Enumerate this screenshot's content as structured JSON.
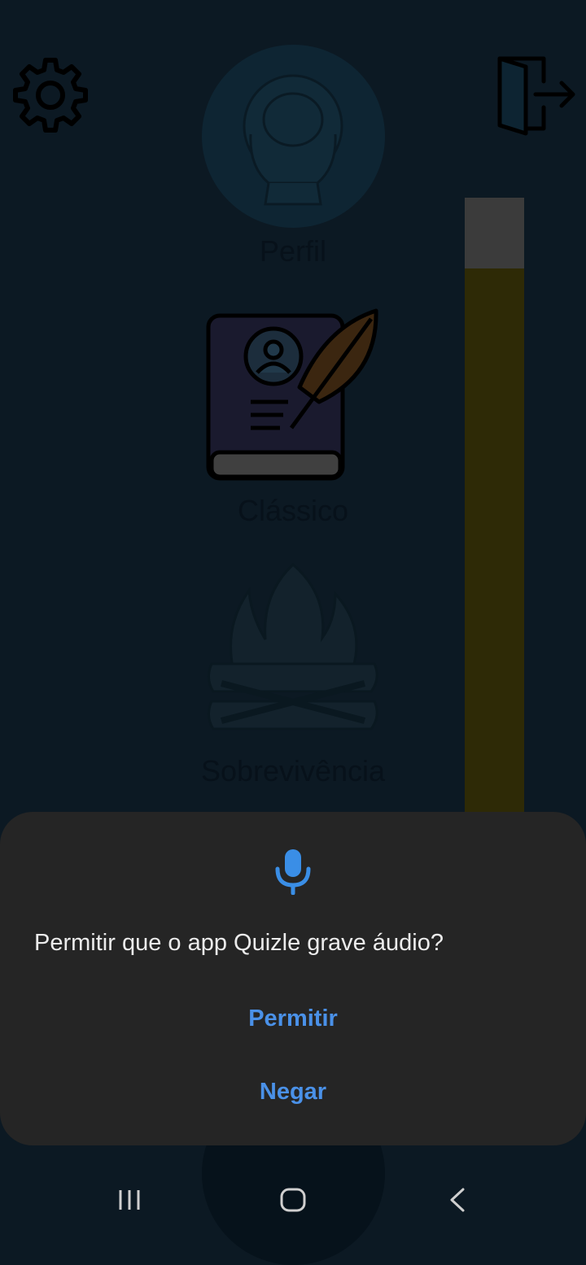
{
  "menu": {
    "profile_label": "Perfil",
    "classic_label": "Clássico",
    "survival_label": "Sobrevivência",
    "progress_fraction": 0.885
  },
  "dialog": {
    "message": "Permitir que o app Quizle grave áudio?",
    "allow_label": "Permitir",
    "deny_label": "Negar",
    "accent_color": "#4a91e8"
  },
  "icons": {
    "settings": "gear-icon",
    "logout": "exit-door-icon",
    "profile": "user-avatar-icon",
    "classic": "book-quill-icon",
    "survival": "campfire-icon",
    "permission": "microphone-icon"
  },
  "navigation": [
    "recents-icon",
    "home-icon",
    "back-icon"
  ]
}
